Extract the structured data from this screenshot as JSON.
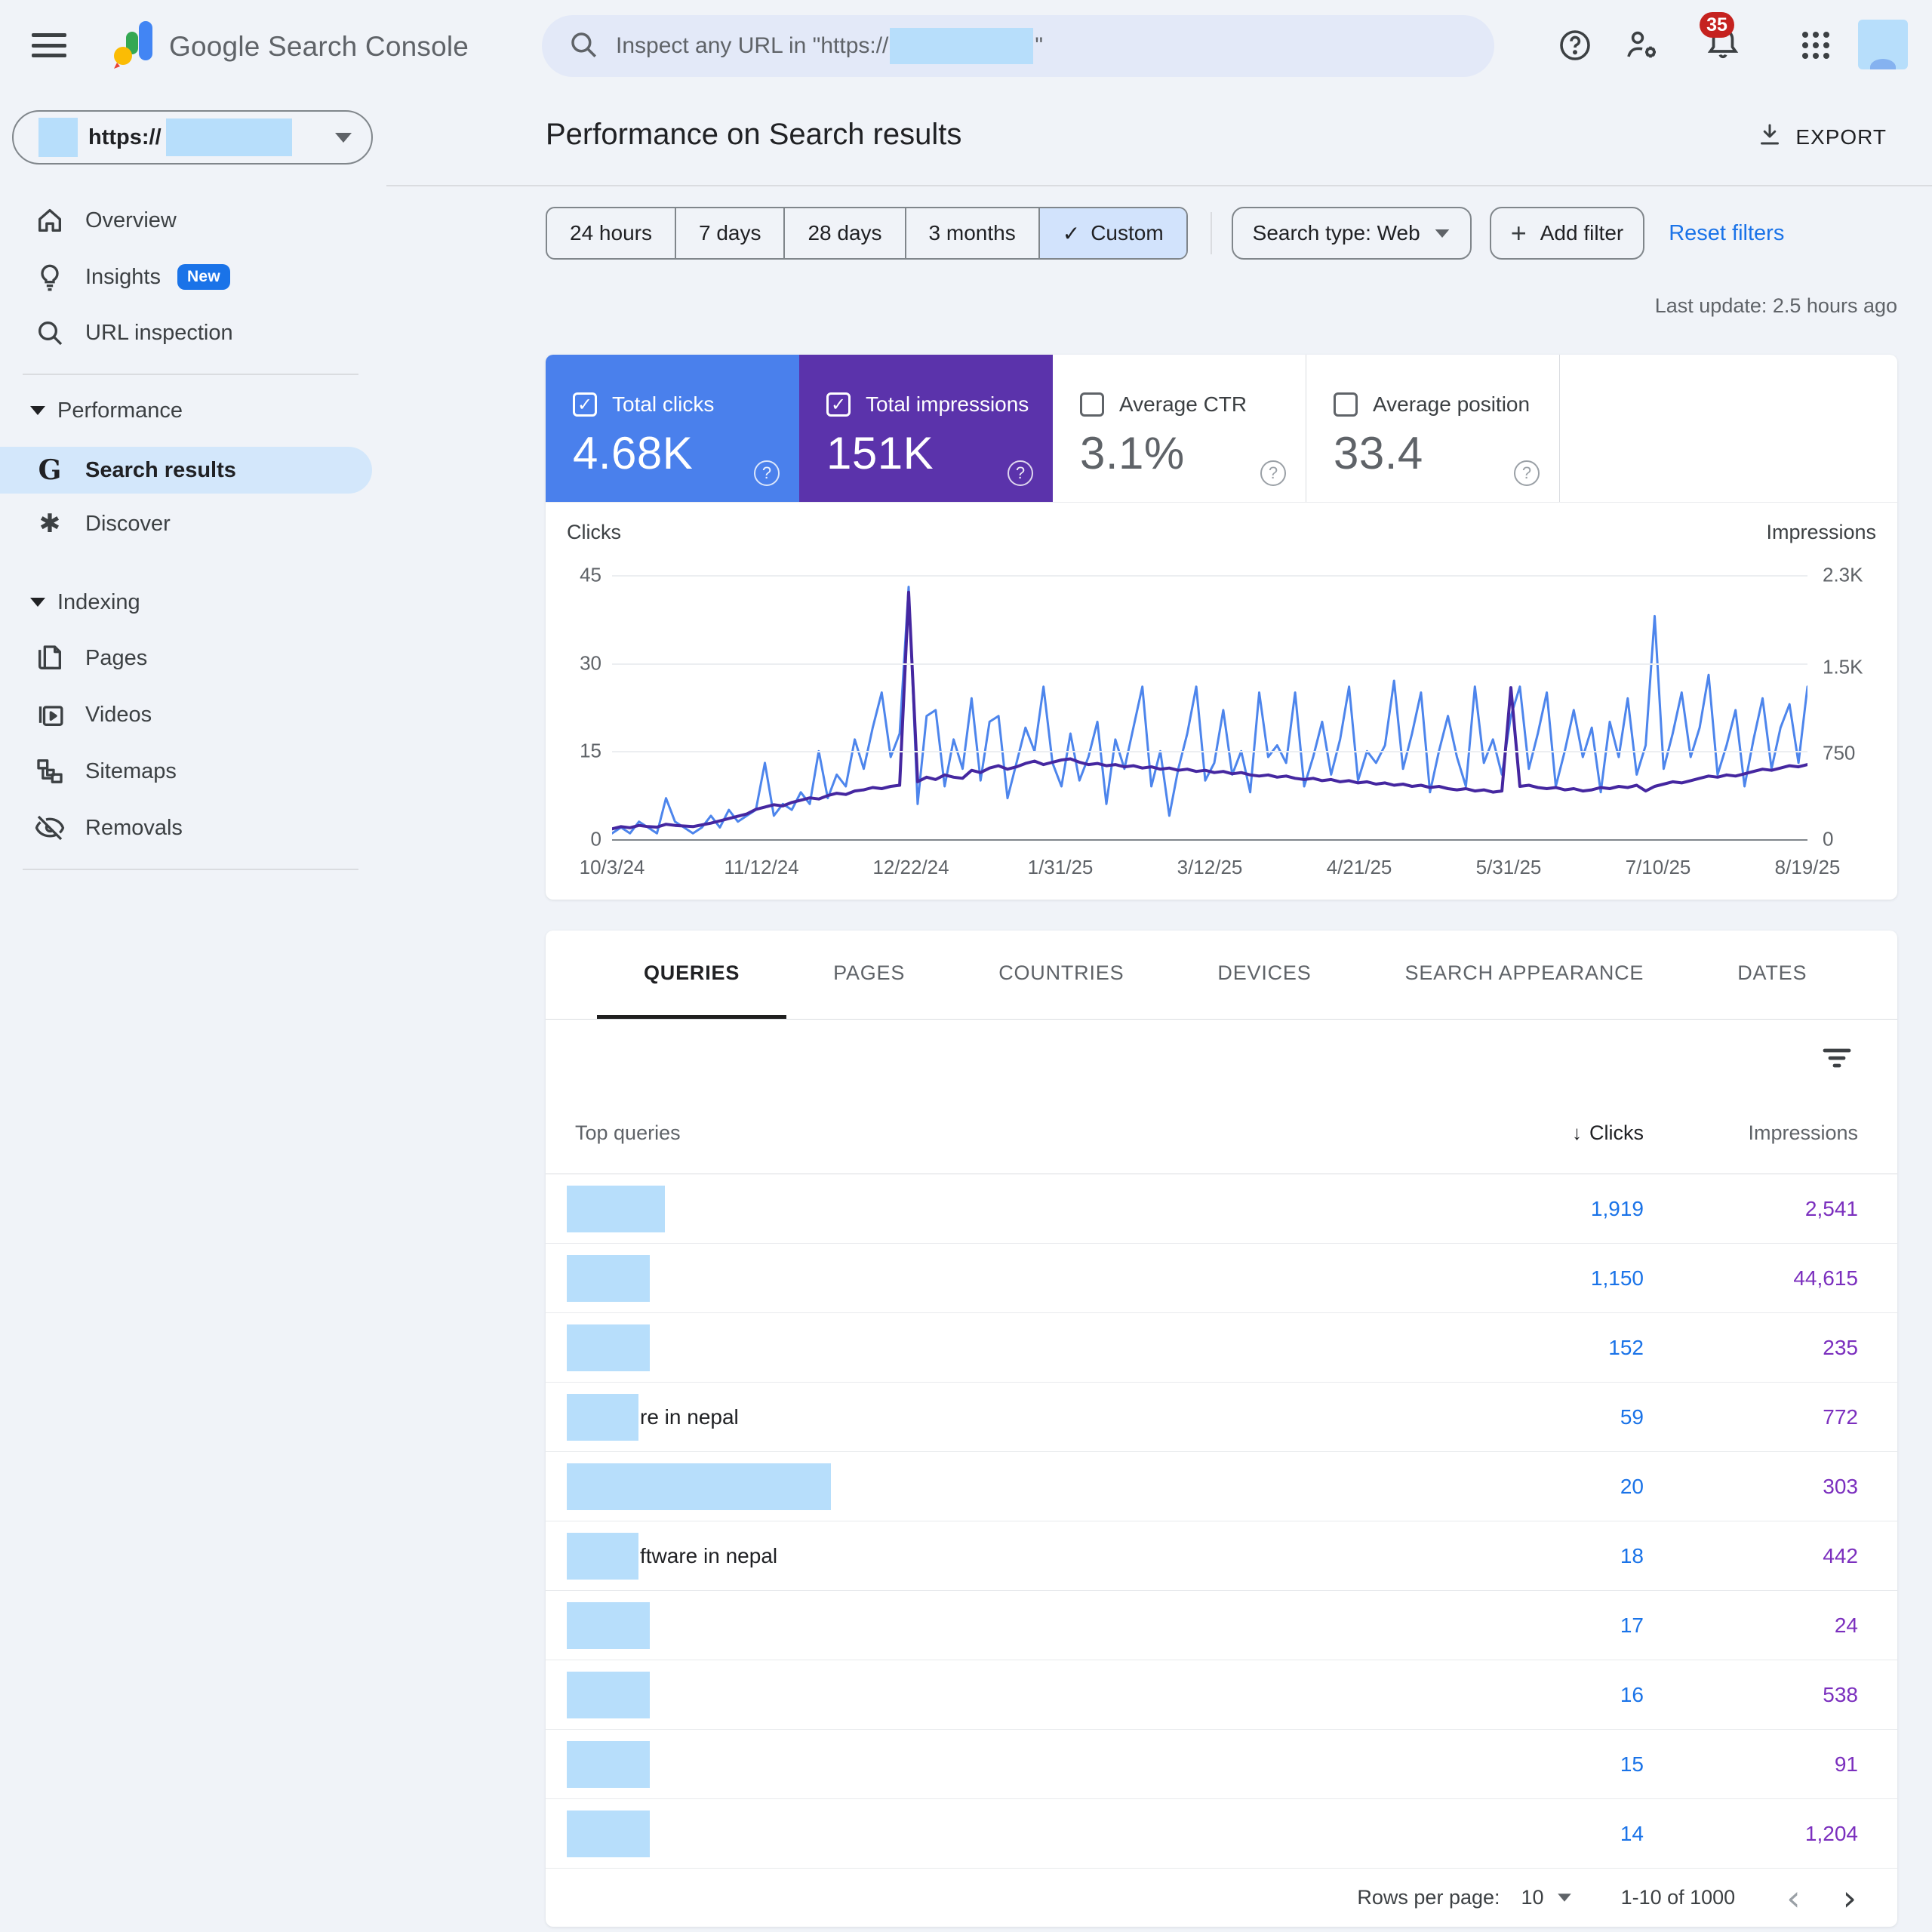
{
  "topbar": {
    "logo_text": "Google Search Console",
    "search_placeholder_prefix": "Inspect any URL in \"https://",
    "search_placeholder_suffix": "\"",
    "notification_count": "35"
  },
  "sidebar": {
    "property": {
      "protocol": "https://"
    },
    "overview_label": "Overview",
    "insights_label": "Insights",
    "insights_badge": "New",
    "url_inspection_label": "URL inspection",
    "performance_section": "Performance",
    "search_results_label": "Search results",
    "discover_label": "Discover",
    "indexing_section": "Indexing",
    "pages_label": "Pages",
    "videos_label": "Videos",
    "sitemaps_label": "Sitemaps",
    "removals_label": "Removals"
  },
  "header": {
    "title": "Performance on Search results",
    "export_label": "EXPORT",
    "last_update": "Last update: 2.5 hours ago"
  },
  "filters": {
    "date_ranges": [
      {
        "label": "24 hours",
        "active": false
      },
      {
        "label": "7 days",
        "active": false
      },
      {
        "label": "28 days",
        "active": false
      },
      {
        "label": "3 months",
        "active": false
      },
      {
        "label": "Custom",
        "active": true
      }
    ],
    "active_check": "✓",
    "search_type_label": "Search type: Web",
    "add_filter_label": "Add filter",
    "reset_label": "Reset filters"
  },
  "metrics": {
    "cards": [
      {
        "label": "Total clicks",
        "value": "4.68K",
        "checked": true,
        "bg": "#4a80ec",
        "help": "?"
      },
      {
        "label": "Total impressions",
        "value": "151K",
        "checked": true,
        "bg": "#5b33ab",
        "help": "?"
      },
      {
        "label": "Average CTR",
        "value": "3.1%",
        "checked": false,
        "bg": "#ffffff",
        "help": "?"
      },
      {
        "label": "Average position",
        "value": "33.4",
        "checked": false,
        "bg": "#ffffff",
        "help": "?"
      }
    ]
  },
  "chart_data": {
    "type": "line",
    "grid": "horizontal",
    "legend": "none",
    "x_axis": {
      "tick_labels": [
        "10/3/24",
        "11/12/24",
        "12/22/24",
        "1/31/25",
        "3/12/25",
        "4/21/25",
        "5/31/25",
        "7/10/25",
        "8/19/25"
      ]
    },
    "left_axis": {
      "label": "Clicks",
      "ticks": [
        "0",
        "15",
        "30",
        "45"
      ],
      "tick_values": [
        0,
        15,
        30,
        45
      ],
      "max": 45
    },
    "right_axis": {
      "label": "Impressions",
      "ticks": [
        "0",
        "750",
        "1.5K",
        "2.3K"
      ],
      "tick_values": [
        0,
        750,
        1500,
        2300
      ],
      "max": 2300
    },
    "series": [
      {
        "name": "Clicks",
        "axis": "left",
        "color": "#4d85ec",
        "width": 3,
        "values": [
          1,
          2,
          1,
          3,
          2,
          1,
          7,
          3,
          2,
          1,
          2,
          4,
          2,
          5,
          3,
          4,
          5,
          13,
          4,
          6,
          5,
          8,
          6,
          15,
          7,
          11,
          9,
          17,
          12,
          19,
          25,
          14,
          18,
          43,
          6,
          21,
          22,
          9,
          17,
          12,
          24,
          10,
          20,
          21,
          7,
          13,
          19,
          15,
          26,
          13,
          9,
          18,
          10,
          14,
          20,
          6,
          17,
          12,
          19,
          26,
          9,
          15,
          4,
          12,
          18,
          26,
          10,
          13,
          22,
          11,
          15,
          8,
          25,
          14,
          16,
          13,
          25,
          9,
          14,
          20,
          11,
          17,
          26,
          10,
          15,
          13,
          16,
          27,
          12,
          18,
          25,
          8,
          15,
          21,
          14,
          9,
          26,
          13,
          17,
          11,
          21,
          26,
          12,
          18,
          25,
          9,
          15,
          22,
          14,
          19,
          8,
          20,
          14,
          24,
          11,
          16,
          38,
          12,
          18,
          25,
          14,
          19,
          28,
          11,
          16,
          22,
          9,
          17,
          24,
          12,
          19,
          23,
          13,
          26
        ]
      },
      {
        "name": "Impressions",
        "axis": "right",
        "color": "#4527a0",
        "width": 4,
        "values": [
          90,
          110,
          100,
          120,
          110,
          105,
          130,
          120,
          115,
          110,
          125,
          140,
          160,
          180,
          200,
          220,
          260,
          280,
          300,
          290,
          320,
          340,
          360,
          350,
          380,
          400,
          390,
          420,
          430,
          450,
          440,
          460,
          470,
          2150,
          500,
          540,
          520,
          560,
          540,
          530,
          600,
          580,
          620,
          640,
          610,
          630,
          660,
          680,
          650,
          670,
          690,
          700,
          670,
          650,
          660,
          640,
          650,
          630,
          640,
          620,
          630,
          610,
          620,
          600,
          610,
          590,
          600,
          580,
          590,
          570,
          580,
          560,
          550,
          560,
          540,
          550,
          530,
          520,
          530,
          510,
          520,
          500,
          510,
          490,
          500,
          480,
          490,
          470,
          480,
          460,
          470,
          450,
          460,
          440,
          430,
          440,
          420,
          430,
          410,
          420,
          1320,
          460,
          470,
          450,
          440,
          450,
          430,
          440,
          420,
          430,
          450,
          440,
          460,
          450,
          470,
          420,
          460,
          480,
          500,
          490,
          510,
          530,
          550,
          540,
          560,
          550,
          570,
          590,
          610,
          600,
          620,
          640,
          630,
          650
        ]
      }
    ]
  },
  "table": {
    "tabs": [
      {
        "label": "QUERIES",
        "active": true
      },
      {
        "label": "PAGES",
        "active": false
      },
      {
        "label": "COUNTRIES",
        "active": false
      },
      {
        "label": "DEVICES",
        "active": false
      },
      {
        "label": "SEARCH APPEARANCE",
        "active": false
      },
      {
        "label": "DATES",
        "active": false
      }
    ],
    "header": {
      "queries": "Top queries",
      "clicks": "Clicks",
      "impressions": "Impressions",
      "sort_arrow": "↓"
    },
    "rows": [
      {
        "visible_text": "",
        "clicks": "1,919",
        "impressions": "2,541",
        "redact_width": 130
      },
      {
        "visible_text": "",
        "clicks": "1,150",
        "impressions": "44,615",
        "redact_width": 110
      },
      {
        "visible_text": "",
        "clicks": "152",
        "impressions": "235",
        "redact_width": 110
      },
      {
        "visible_text": "re in nepal",
        "clicks": "59",
        "impressions": "772",
        "redact_width": 95
      },
      {
        "visible_text": "",
        "clicks": "20",
        "impressions": "303",
        "redact_width": 350
      },
      {
        "visible_text": "ftware in nepal",
        "clicks": "18",
        "impressions": "442",
        "redact_width": 95
      },
      {
        "visible_text": "",
        "clicks": "17",
        "impressions": "24",
        "redact_width": 110
      },
      {
        "visible_text": "",
        "clicks": "16",
        "impressions": "538",
        "redact_width": 110
      },
      {
        "visible_text": "",
        "clicks": "15",
        "impressions": "91",
        "redact_width": 110
      },
      {
        "visible_text": "",
        "clicks": "14",
        "impressions": "1,204",
        "redact_width": 110
      }
    ]
  },
  "pagination": {
    "rows_per_page_label": "Rows per page:",
    "rows_per_page": "10",
    "range": "1-10 of 1000",
    "prev": "‹",
    "next": "›"
  }
}
